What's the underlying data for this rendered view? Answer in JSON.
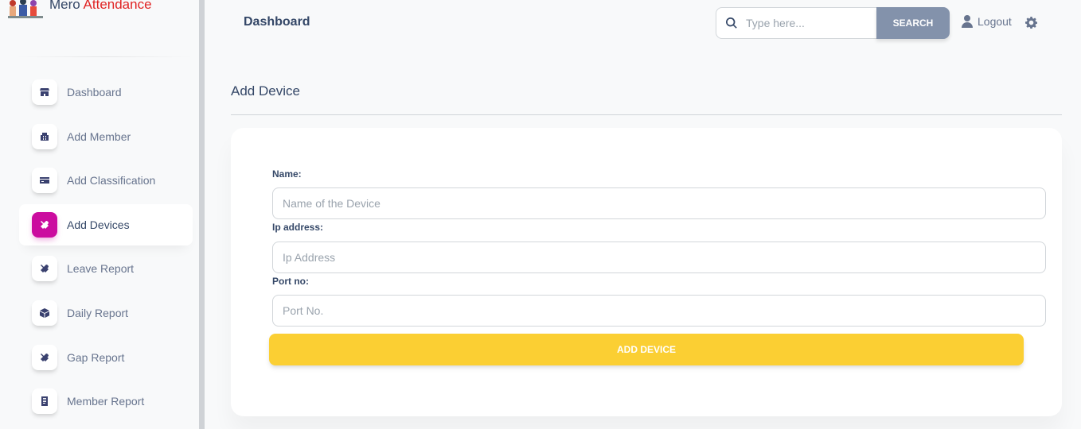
{
  "brand": {
    "name_part1": "Mero",
    "name_part2": "Attendance"
  },
  "colors": {
    "accent": "#cb0c9f",
    "brand_red": "#e02424",
    "button_yellow": "#fbcf33",
    "search_button": "#8392ab",
    "text": "#344767"
  },
  "sidebar": {
    "items": [
      {
        "label": "Dashboard",
        "icon": "shop-icon",
        "active": false
      },
      {
        "label": "Add Member",
        "icon": "office-icon",
        "active": false
      },
      {
        "label": "Add Classification",
        "icon": "credit-card-icon",
        "active": false
      },
      {
        "label": "Add Devices",
        "icon": "tools-icon",
        "active": true
      },
      {
        "label": "Leave Report",
        "icon": "tools-icon",
        "active": false
      },
      {
        "label": "Daily Report",
        "icon": "box-icon",
        "active": false
      },
      {
        "label": "Gap Report",
        "icon": "tools-icon",
        "active": false
      },
      {
        "label": "Member Report",
        "icon": "document-icon",
        "active": false
      }
    ]
  },
  "topbar": {
    "title": "Dashboard",
    "search_placeholder": "Type here...",
    "search_button": "SEARCH",
    "logout": "Logout"
  },
  "page": {
    "title": "Add Device"
  },
  "form": {
    "name_label": "Name:",
    "name_placeholder": "Name of the Device",
    "ip_label": "Ip address:",
    "ip_placeholder": "Ip Address",
    "port_label": "Port no:",
    "port_placeholder": "Port No.",
    "submit": "ADD DEVICE"
  }
}
